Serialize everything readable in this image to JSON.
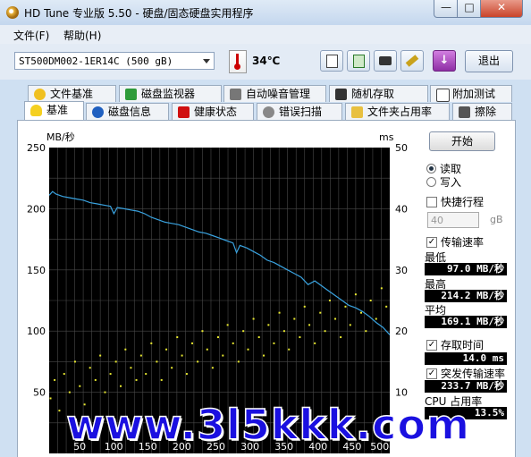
{
  "window": {
    "title": "HD Tune 专业版 5.50 - 硬盘/固态硬盘实用程序",
    "minimize": "—",
    "maximize": "□",
    "close": "✕"
  },
  "menu": [
    "文件(F)",
    "帮助(H)"
  ],
  "toolbar": {
    "drive": "ST500DM002-1ER14C (500 gB)",
    "temperature": "34℃",
    "icons": [
      "copy-text-icon",
      "copy-info-icon",
      "camera-icon",
      "wrench-icon",
      "download-icon"
    ],
    "exit": "退出"
  },
  "tabs_top": [
    "文件基准",
    "磁盘监视器",
    "自动噪音管理",
    "随机存取",
    "附加测试"
  ],
  "tabs_bottom": [
    "基准",
    "磁盘信息",
    "健康状态",
    "错误扫描",
    "文件夹占用率",
    "擦除"
  ],
  "active_tab": "基准",
  "controls": {
    "start": "开始",
    "read": "读取",
    "write": "写入",
    "quick_stroke": "快捷行程",
    "stroke_value": "40",
    "stroke_unit": "gB",
    "transfer_rate": "传输速率",
    "min_label": "最低",
    "min_value": "97.0 MB/秒",
    "max_label": "最高",
    "max_value": "214.2 MB/秒",
    "avg_label": "平均",
    "avg_value": "169.1 MB/秒",
    "access_time": "存取时间",
    "access_value": "14.0 ms",
    "burst_rate": "突发传输速率",
    "burst_value": "233.7 MB/秒",
    "cpu_label": "CPU 占用率",
    "cpu_value": "13.5%"
  },
  "watermark": "www.3l5kkk.com",
  "chart_data": {
    "type": "line",
    "ylabel_left": "MB/秒",
    "ylabel_right": "ms",
    "y_ticks_left": [
      "250",
      "200",
      "150",
      "100",
      "50"
    ],
    "y_ticks_right": [
      "50",
      "40",
      "30",
      "20",
      "10"
    ],
    "x_ticks": [
      "50",
      "100",
      "150",
      "200",
      "250",
      "300",
      "350",
      "400",
      "450",
      "500gB"
    ],
    "xlim": [
      0,
      500
    ],
    "ylim_left": [
      0,
      250
    ],
    "ylim_right": [
      0,
      50
    ],
    "grid": true,
    "series": [
      {
        "kind": "transfer",
        "color": "#3aa3e0",
        "x": [
          0,
          5,
          10,
          20,
          30,
          40,
          50,
          60,
          70,
          80,
          90,
          95,
          100,
          110,
          120,
          130,
          140,
          150,
          160,
          170,
          180,
          190,
          200,
          210,
          220,
          230,
          240,
          250,
          260,
          270,
          275,
          280,
          290,
          300,
          310,
          320,
          330,
          340,
          350,
          360,
          370,
          380,
          390,
          400,
          410,
          420,
          430,
          440,
          450,
          460,
          470,
          480,
          490,
          500
        ],
        "y": [
          211,
          214,
          212,
          210,
          209,
          208,
          207,
          205,
          204,
          203,
          202,
          196,
          201,
          200,
          199,
          198,
          196,
          193,
          191,
          189,
          188,
          187,
          185,
          183,
          181,
          180,
          178,
          176,
          174,
          172,
          164,
          170,
          168,
          165,
          162,
          158,
          156,
          153,
          150,
          147,
          144,
          138,
          141,
          137,
          133,
          129,
          125,
          121,
          119,
          116,
          112,
          107,
          103,
          97
        ]
      },
      {
        "kind": "access-time",
        "color": "#e8e830",
        "note": "scatter points in ms",
        "x": [
          2,
          8,
          15,
          22,
          30,
          38,
          45,
          52,
          60,
          68,
          75,
          82,
          90,
          98,
          105,
          112,
          120,
          128,
          135,
          142,
          150,
          158,
          165,
          172,
          180,
          188,
          195,
          202,
          210,
          218,
          225,
          232,
          240,
          248,
          255,
          262,
          270,
          278,
          285,
          292,
          300,
          308,
          315,
          322,
          330,
          338,
          345,
          352,
          360,
          368,
          375,
          382,
          390,
          398,
          405,
          412,
          420,
          428,
          435,
          442,
          450,
          458,
          465,
          472,
          480,
          488,
          495
        ],
        "y": [
          9,
          12,
          7,
          13,
          10,
          15,
          11,
          8,
          14,
          12,
          16,
          10,
          13,
          15,
          11,
          17,
          14,
          12,
          16,
          13,
          18,
          15,
          12,
          17,
          14,
          19,
          16,
          13,
          18,
          15,
          20,
          17,
          14,
          19,
          16,
          21,
          18,
          15,
          20,
          17,
          22,
          19,
          16,
          21,
          18,
          23,
          20,
          17,
          22,
          19,
          24,
          21,
          18,
          23,
          20,
          25,
          22,
          19,
          24,
          21,
          26,
          23,
          20,
          25,
          22,
          27,
          24
        ]
      }
    ]
  }
}
